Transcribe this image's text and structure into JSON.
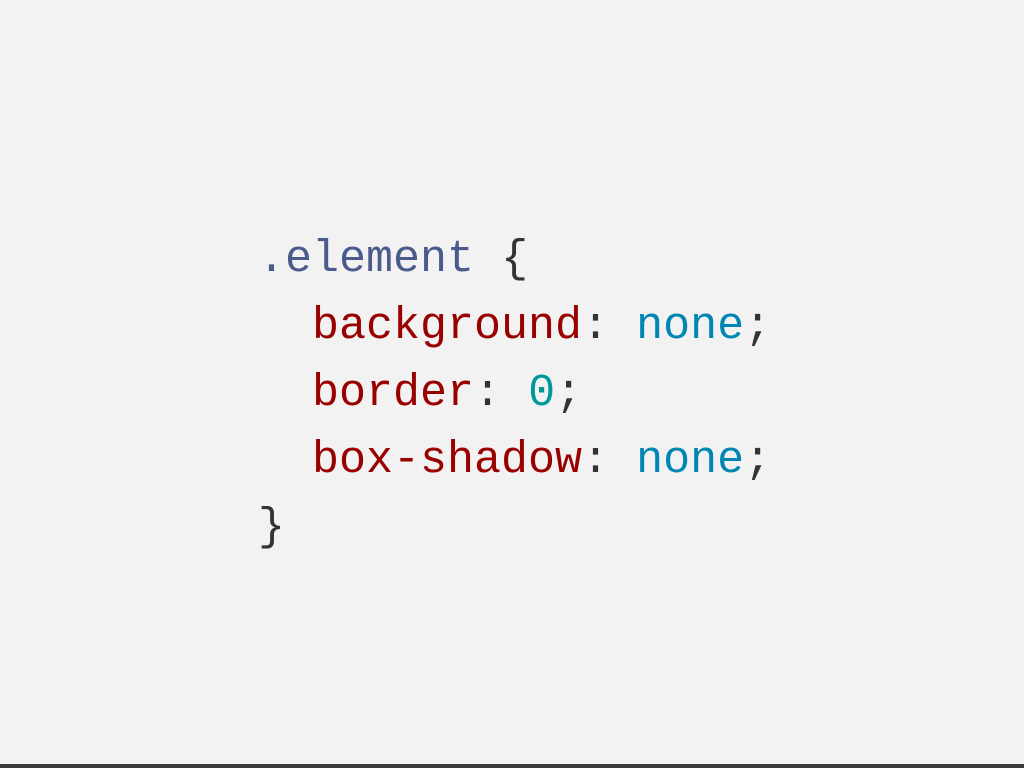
{
  "code": {
    "selector": ".element",
    "open_brace": "{",
    "close_brace": "}",
    "declarations": [
      {
        "property": "background",
        "colon": ":",
        "value": "none",
        "semicolon": ";"
      },
      {
        "property": "border",
        "colon": ":",
        "value": "0",
        "semicolon": ";"
      },
      {
        "property": "box-shadow",
        "colon": ":",
        "value": "none",
        "semicolon": ";"
      }
    ]
  },
  "colors": {
    "background": "#f2f2f2",
    "selector": "#4a5a8c",
    "punctuation": "#333333",
    "property": "#990000",
    "keyword_value": "#0086b3",
    "number_value": "#009999",
    "bottom_bar": "#3a3a3a"
  }
}
